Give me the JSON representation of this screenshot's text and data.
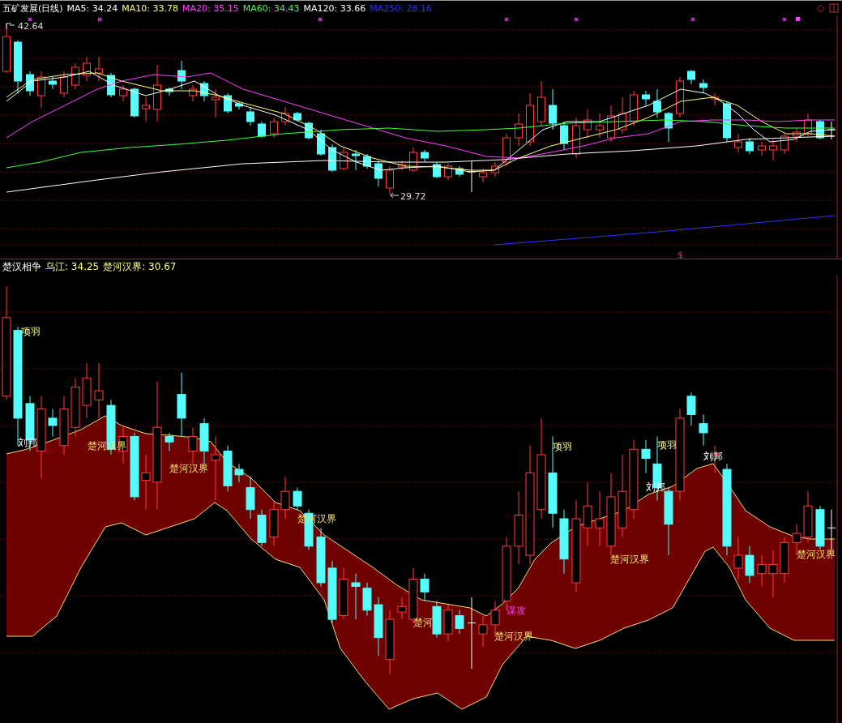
{
  "header": {
    "title": "五矿发展(日线)",
    "ma": [
      {
        "label": "MA5: 34.24",
        "color": "#ffffff"
      },
      {
        "label": "MA10: 33.78",
        "color": "#ffff80"
      },
      {
        "label": "MA20: 35.15",
        "color": "#ff40ff"
      },
      {
        "label": "MA60: 34.43",
        "color": "#40ff40"
      },
      {
        "label": "MA120: 33.66",
        "color": "#ffffff"
      },
      {
        "label": "MA250: 28.16",
        "color": "#3030ff"
      }
    ]
  },
  "price_panel": {
    "high_label": "42.64",
    "low_label": "29.72",
    "signal_mark": "$"
  },
  "indicator_panel": {
    "legend": [
      {
        "label": "楚汉相争"
      },
      {
        "label": "乌江: 34.25",
        "color": "#ffff80"
      },
      {
        "label": "楚河汉界: 30.67",
        "color": "#ffff80"
      }
    ],
    "labels": [
      {
        "text": "项羽",
        "kind": "xiangyu"
      },
      {
        "text": "刘邦",
        "kind": "liubang"
      },
      {
        "text": "楚河汉界",
        "kind": "chuhe"
      },
      {
        "text": "楚河汉界",
        "kind": "chuhe"
      },
      {
        "text": "楚河汉界",
        "kind": "chuhe"
      },
      {
        "text": "楚河",
        "kind": "chuhe"
      },
      {
        "text": "谋攻",
        "kind": "mougong"
      },
      {
        "text": "楚河汉界",
        "kind": "chuhe"
      },
      {
        "text": "项羽",
        "kind": "xiangyu"
      },
      {
        "text": "刘邦",
        "kind": "liubang"
      },
      {
        "text": "楚河汉界",
        "kind": "chuhe"
      },
      {
        "text": "项羽",
        "kind": "xiangyu"
      },
      {
        "text": "刘邦",
        "kind": "liubang"
      },
      {
        "text": "楚河汉界",
        "kind": "chuhe"
      }
    ]
  }
}
